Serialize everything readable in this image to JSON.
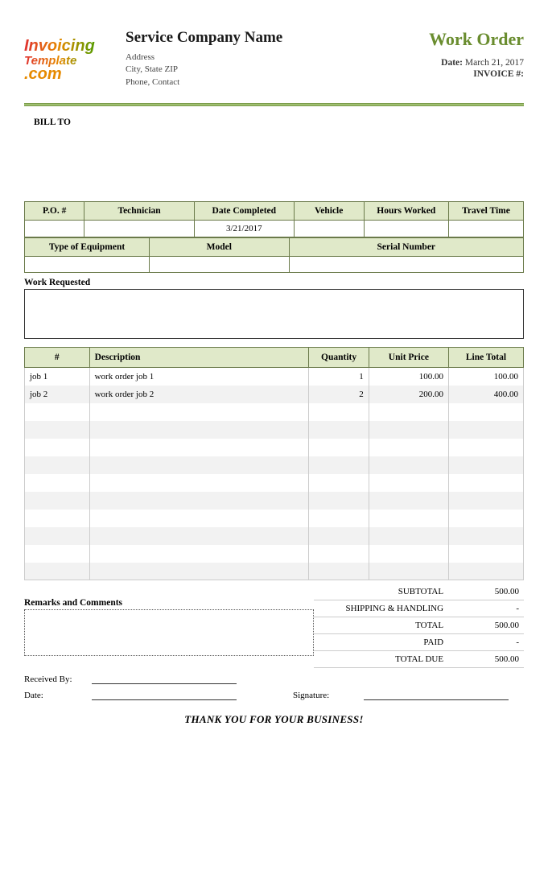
{
  "logo": {
    "line1": "Invoicing",
    "line2": "Template",
    "line3": ".com"
  },
  "company": {
    "name": "Service Company Name",
    "address": "Address",
    "citystatezip": "City, State ZIP",
    "phone": "Phone, Contact"
  },
  "header_right": {
    "title": "Work Order",
    "date_label": "Date:",
    "date_value": "March 21, 2017",
    "invoice_label": "INVOICE #:",
    "invoice_value": ""
  },
  "billto_label": "BILL TO",
  "info1": {
    "headers": [
      "P.O. #",
      "Technician",
      "Date Completed",
      "Vehicle",
      "Hours Worked",
      "Travel Time"
    ],
    "values": [
      "",
      "",
      "3/21/2017",
      "",
      "",
      ""
    ]
  },
  "info2": {
    "headers": [
      "Type of Equipment",
      "Model",
      "Serial Number"
    ],
    "values": [
      "",
      "",
      ""
    ]
  },
  "work_requested_label": "Work Requested",
  "items_headers": {
    "num": "#",
    "desc": "Description",
    "qty": "Quantity",
    "uprice": "Unit Price",
    "ltotal": "Line Total"
  },
  "items": [
    {
      "num": "job 1",
      "desc": "work order job 1",
      "qty": "1",
      "uprice": "100.00",
      "ltotal": "100.00"
    },
    {
      "num": "job 2",
      "desc": "work order job 2",
      "qty": "2",
      "uprice": "200.00",
      "ltotal": "400.00"
    },
    {
      "num": "",
      "desc": "",
      "qty": "",
      "uprice": "",
      "ltotal": ""
    },
    {
      "num": "",
      "desc": "",
      "qty": "",
      "uprice": "",
      "ltotal": ""
    },
    {
      "num": "",
      "desc": "",
      "qty": "",
      "uprice": "",
      "ltotal": ""
    },
    {
      "num": "",
      "desc": "",
      "qty": "",
      "uprice": "",
      "ltotal": ""
    },
    {
      "num": "",
      "desc": "",
      "qty": "",
      "uprice": "",
      "ltotal": ""
    },
    {
      "num": "",
      "desc": "",
      "qty": "",
      "uprice": "",
      "ltotal": ""
    },
    {
      "num": "",
      "desc": "",
      "qty": "",
      "uprice": "",
      "ltotal": ""
    },
    {
      "num": "",
      "desc": "",
      "qty": "",
      "uprice": "",
      "ltotal": ""
    },
    {
      "num": "",
      "desc": "",
      "qty": "",
      "uprice": "",
      "ltotal": ""
    },
    {
      "num": "",
      "desc": "",
      "qty": "",
      "uprice": "",
      "ltotal": ""
    }
  ],
  "totals": {
    "subtotal_label": "SUBTOTAL",
    "subtotal_value": "500.00",
    "shipping_label": "SHIPPING & HANDLING",
    "shipping_value": "-",
    "total_label": "TOTAL",
    "total_value": "500.00",
    "paid_label": "PAID",
    "paid_value": "-",
    "due_label": "TOTAL DUE",
    "due_value": "500.00"
  },
  "remarks_label": "Remarks and Comments",
  "sign": {
    "received_label": "Received By:",
    "date_label": "Date:",
    "signature_label": "Signature:"
  },
  "thanks": "THANK YOU FOR YOUR BUSINESS!"
}
